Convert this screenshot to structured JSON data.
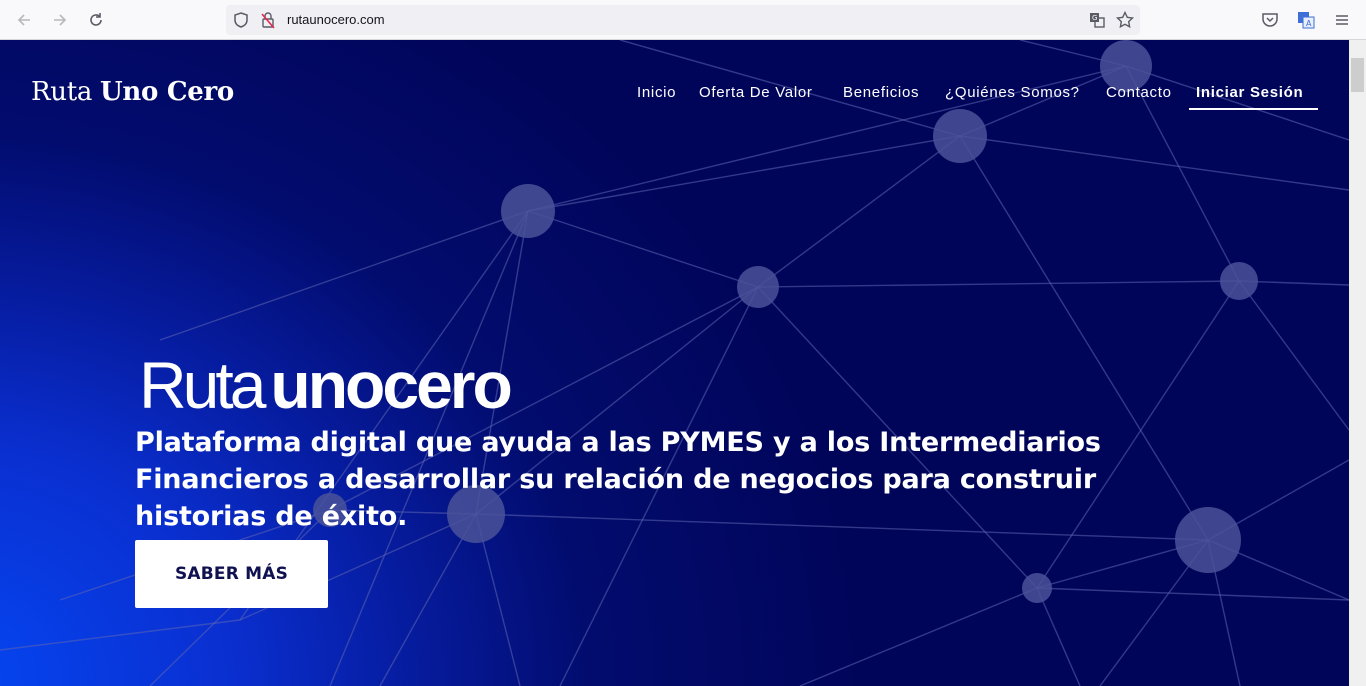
{
  "browser": {
    "url": "rutaunocero.com",
    "icons": [
      "back-arrow-icon",
      "forward-arrow-icon",
      "reload-icon",
      "shield-icon",
      "insecure-lock-icon",
      "translate-icon",
      "bookmark-star-icon",
      "pocket-icon",
      "extension-translate-icon",
      "menu-hamburger-icon"
    ]
  },
  "site": {
    "logo_regular": "Ruta",
    "logo_bold": "Uno Cero",
    "nav": {
      "inicio": "Inicio",
      "oferta": "Oferta De Valor",
      "beneficios": "Beneficios",
      "quienes": "¿Quiénes Somos?",
      "contacto": "Contacto",
      "login": "Iniciar Sesión"
    },
    "hero": {
      "title_light": "Ruta",
      "title_bold": "unocero",
      "subtitle": "Plataforma digital que ayuda a las PYMES y a los Intermediarios Financieros a desarrollar su relación de negocios para construir historias de éxito.",
      "cta": "SABER MÁS"
    }
  },
  "colors": {
    "hero_dark": "#01055a",
    "hero_bright": "#0546f2",
    "cta_text": "#0f1150",
    "node": "#4a5299"
  }
}
